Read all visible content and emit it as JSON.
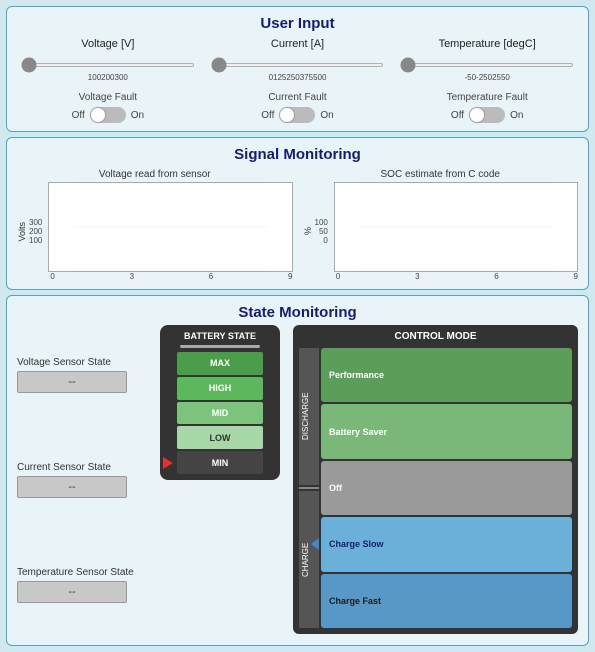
{
  "userInput": {
    "title": "User Input",
    "sliders": [
      {
        "label": "Voltage [V]",
        "min": 100,
        "max": 300,
        "value": 100,
        "ticks": [
          "100",
          "200",
          "300"
        ]
      },
      {
        "label": "Current [A]",
        "min": 0,
        "max": 500,
        "value": 0,
        "ticks": [
          "0",
          "125",
          "250",
          "375",
          "500"
        ]
      },
      {
        "label": "Temperature [degC]",
        "min": -50,
        "max": 50,
        "value": -50,
        "ticks": [
          "-50",
          "-25",
          "0",
          "25",
          "50"
        ]
      }
    ],
    "faults": [
      {
        "label": "Voltage Fault",
        "offLabel": "Off",
        "onLabel": "On"
      },
      {
        "label": "Current Fault",
        "offLabel": "Off",
        "onLabel": "On"
      },
      {
        "label": "Temperature Fault",
        "offLabel": "Off",
        "onLabel": "On"
      }
    ]
  },
  "signalMonitoring": {
    "title": "Signal Monitoring",
    "charts": [
      {
        "title": "Voltage read from sensor",
        "yUnit": "Volts",
        "yLabels": [
          "300",
          "200",
          "100"
        ],
        "xLabels": [
          "0",
          "3",
          "6",
          "9"
        ]
      },
      {
        "title": "SOC estimate from C code",
        "yUnit": "%",
        "yLabels": [
          "100",
          "50",
          "0"
        ],
        "xLabels": [
          "0",
          "3",
          "6",
          "9"
        ]
      }
    ]
  },
  "stateMonitoring": {
    "title": "State Monitoring",
    "sensors": [
      {
        "label": "Voltage Sensor State",
        "value": "--"
      },
      {
        "label": "Current Sensor State",
        "value": "--"
      },
      {
        "label": "Temperature Sensor State",
        "value": "--"
      }
    ],
    "batteryState": {
      "title": "BATTERY STATE",
      "levels": [
        "MAX",
        "HIGH",
        "MID",
        "LOW",
        "MIN"
      ]
    },
    "controlMode": {
      "title": "CONTROL MODE",
      "dischargeLabel": "DISCHARGE",
      "chargeLabel": "CHARGE",
      "buttons": [
        {
          "label": "Performance",
          "group": "discharge",
          "active": false
        },
        {
          "label": "Battery Saver",
          "group": "discharge",
          "active": false
        },
        {
          "label": "Off",
          "group": "none",
          "active": false
        },
        {
          "label": "Charge Slow",
          "group": "charge",
          "active": true
        },
        {
          "label": "Charge Fast",
          "group": "charge",
          "active": false
        }
      ]
    }
  }
}
